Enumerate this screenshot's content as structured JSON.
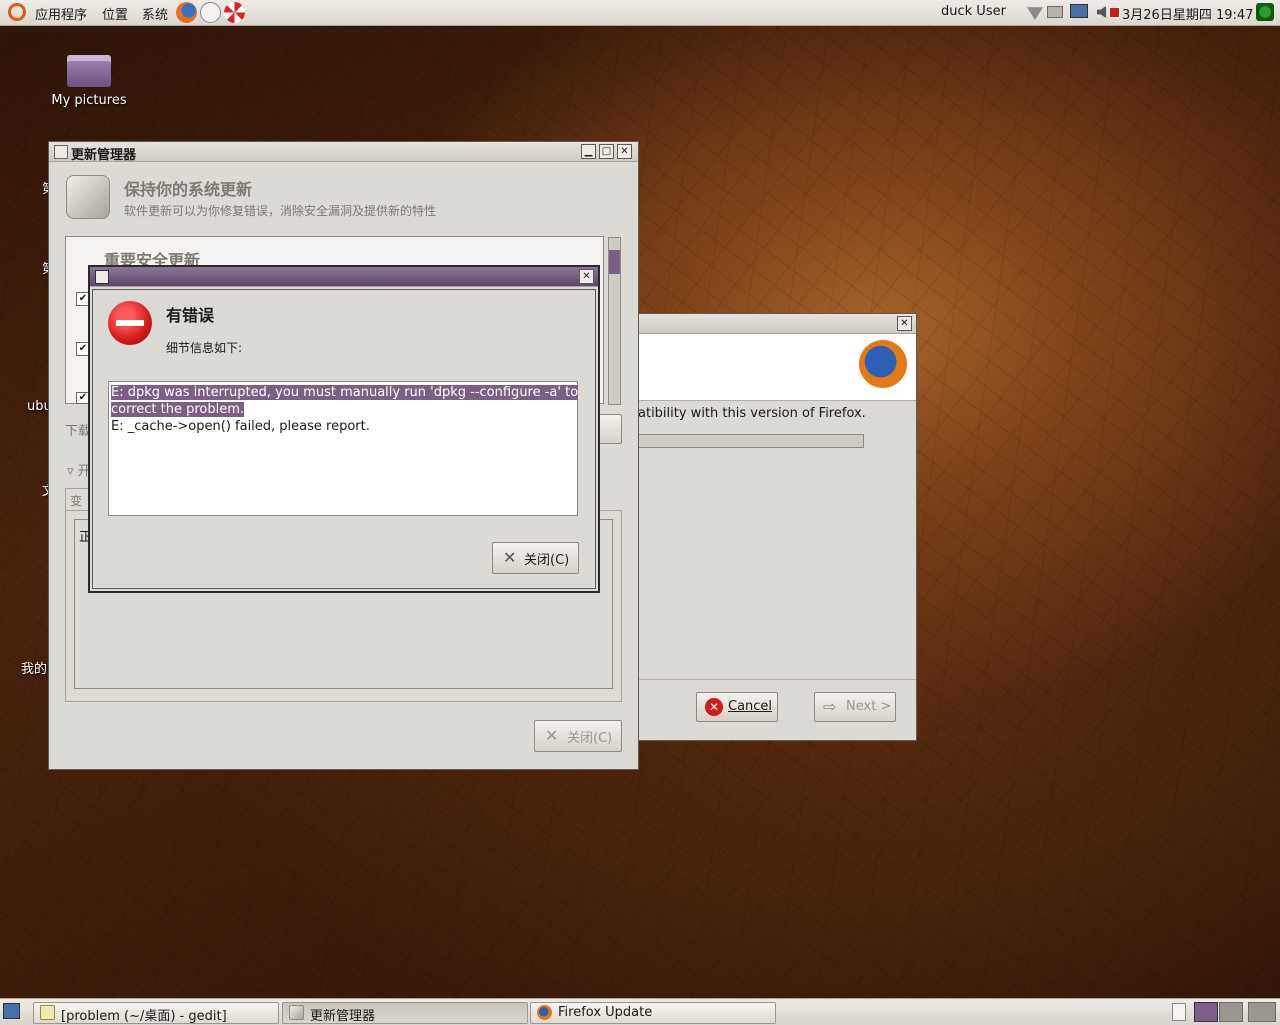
{
  "top_panel": {
    "menus": [
      "应用程序",
      "位置",
      "系统"
    ],
    "user": "duck User",
    "datetime": "3月26日星期四 19:47"
  },
  "desktop": {
    "icon_my_pictures": "My pictures",
    "cut_labels": [
      "第",
      "第",
      "ubu",
      "文",
      "我的"
    ]
  },
  "update_manager": {
    "title": "更新管理器",
    "heading": "保持你的系统更新",
    "subheading": "软件更新可以为你修复错误，消除安全漏洞及提供新的特性",
    "list_header": "重要安全更新",
    "download_label": "下载",
    "expander_label": "开",
    "tab_label": "变",
    "inner_label": "正",
    "close_button": "关闭(C)"
  },
  "firefox_update": {
    "title": "Firefox Update",
    "text_fragment": "atibility with this version of Firefox.",
    "cancel_button": "Cancel",
    "next_button": "Next >"
  },
  "error_dialog": {
    "heading": "有错误",
    "subtitle": "细节信息如下:",
    "line1_part1": "E: dpkg was interrupted, you must manually run 'dpkg --configure -a' to",
    "line1_part2": "correct the problem.",
    "line2": "E: _cache->open() failed, please report.",
    "close_button": "关闭(C)"
  },
  "taskbar": {
    "tasks": [
      "[problem (~/桌面) - gedit]",
      "更新管理器",
      "Firefox Update"
    ]
  },
  "colors": {
    "selection": "#7b5f86",
    "error_red": "#d11b1b"
  }
}
